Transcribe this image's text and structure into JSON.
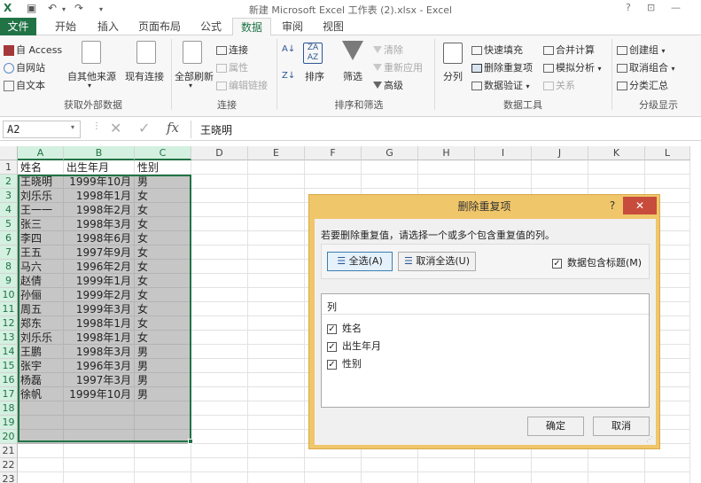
{
  "window": {
    "title": "新建 Microsoft Excel 工作表 (2).xlsx - Excel",
    "help": "?"
  },
  "tabs": [
    "文件",
    "开始",
    "插入",
    "页面布局",
    "公式",
    "数据",
    "审阅",
    "视图"
  ],
  "ribbon": {
    "get_external": {
      "access": "自 Access",
      "web": "自网站",
      "text": "自文本",
      "other": "自其他来源",
      "existing": "现有连接",
      "label": "获取外部数据"
    },
    "connections": {
      "refresh_all": "全部刷新",
      "connect": "连接",
      "props": "属性",
      "edit_links": "编辑链接",
      "label": "连接"
    },
    "sort_filter": {
      "sort": "排序",
      "filter": "筛选",
      "clear": "清除",
      "reapply": "重新应用",
      "advanced": "高级",
      "label": "排序和筛选"
    },
    "data_tools": {
      "split": "分列",
      "flash_fill": "快速填充",
      "remove_dup": "删除重复项",
      "validation": "数据验证",
      "consolidate": "合并计算",
      "what_if": "模拟分析",
      "relations": "关系",
      "label": "数据工具"
    },
    "outline": {
      "group": "创建组",
      "ungroup": "取消组合",
      "subtotal": "分类汇总",
      "label": "分级显示"
    }
  },
  "formula_bar": {
    "name_box": "A2",
    "value": "王晓明"
  },
  "columns": [
    "A",
    "B",
    "C",
    "D",
    "E",
    "F",
    "G",
    "H",
    "I",
    "J",
    "K",
    "L"
  ],
  "rows": [
    [
      "姓名",
      "出生年月",
      "性别"
    ],
    [
      "王晓明",
      "1999年10月",
      "男"
    ],
    [
      "刘乐乐",
      "1998年1月",
      "女"
    ],
    [
      "王一一",
      "1998年2月",
      "女"
    ],
    [
      "张三",
      "1998年3月",
      "女"
    ],
    [
      "李四",
      "1998年6月",
      "女"
    ],
    [
      "王五",
      "1997年9月",
      "女"
    ],
    [
      "马六",
      "1996年2月",
      "女"
    ],
    [
      "赵倩",
      "1999年1月",
      "女"
    ],
    [
      "孙俪",
      "1999年2月",
      "女"
    ],
    [
      "周五",
      "1999年3月",
      "女"
    ],
    [
      "郑东",
      "1998年1月",
      "女"
    ],
    [
      "刘乐乐",
      "1998年1月",
      "女"
    ],
    [
      "王鹏",
      "1998年3月",
      "男"
    ],
    [
      "张宇",
      "1996年3月",
      "男"
    ],
    [
      "杨磊",
      "1997年3月",
      "男"
    ],
    [
      "徐帆",
      "1999年10月",
      "男"
    ]
  ],
  "row_count": 23,
  "dialog": {
    "title": "删除重复项",
    "help": "?",
    "close": "✕",
    "instruction": "若要删除重复值，请选择一个或多个包含重复值的列。",
    "select_all": "全选(A)",
    "unselect_all": "取消全选(U)",
    "has_headers_label": "数据包含标题(M)",
    "has_headers": true,
    "columns_header": "列",
    "columns": [
      {
        "label": "姓名",
        "checked": true
      },
      {
        "label": "出生年月",
        "checked": true
      },
      {
        "label": "性别",
        "checked": true
      }
    ],
    "ok": "确定",
    "cancel": "取消"
  },
  "colors": {
    "accent": "#217346",
    "dialog_frame": "#f0c66a",
    "close_button": "#c84c3c"
  }
}
